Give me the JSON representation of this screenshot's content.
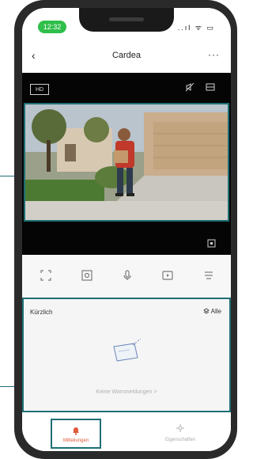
{
  "status": {
    "time": "12:32",
    "icons": "..ıl ᯤ ▭"
  },
  "navbar": {
    "back": "‹",
    "title": "Cardea",
    "more": "···"
  },
  "video": {
    "hd_label": "HD"
  },
  "events": {
    "label": "Kürzlich",
    "all_label": "Alle",
    "empty_text": "Keine Warnmeldungen >"
  },
  "tabs": [
    {
      "label": "Mitteilungen",
      "icon": "bell-icon",
      "active": true
    },
    {
      "label": "Eigenschaften",
      "icon": "settings-icon",
      "active": false
    }
  ],
  "colors": {
    "accent": "#1e6f74",
    "active_tab": "#e05a3c",
    "status_green": "#2fbf4a"
  }
}
